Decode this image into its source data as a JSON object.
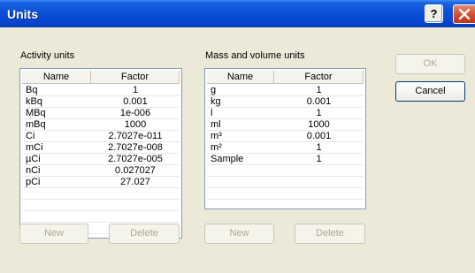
{
  "window": {
    "title": "Units",
    "help_glyph": "?"
  },
  "activity": {
    "label": "Activity units",
    "columns": {
      "name": "Name",
      "factor": "Factor"
    },
    "rows": [
      {
        "name": "Bq",
        "factor": "1"
      },
      {
        "name": "kBq",
        "factor": "0.001"
      },
      {
        "name": "MBq",
        "factor": "1e-006"
      },
      {
        "name": "mBq",
        "factor": "1000"
      },
      {
        "name": "Ci",
        "factor": "2.7027e-011"
      },
      {
        "name": "mCi",
        "factor": "2.7027e-008"
      },
      {
        "name": "µCi",
        "factor": "2.7027e-005"
      },
      {
        "name": "nCi",
        "factor": "0.027027"
      },
      {
        "name": "pCi",
        "factor": "27.027"
      }
    ],
    "new_label": "New",
    "delete_label": "Delete"
  },
  "mass": {
    "label": "Mass and volume units",
    "columns": {
      "name": "Name",
      "factor": "Factor"
    },
    "rows": [
      {
        "name": "g",
        "factor": "1"
      },
      {
        "name": "kg",
        "factor": "0.001"
      },
      {
        "name": "l",
        "factor": "1"
      },
      {
        "name": "ml",
        "factor": "1000"
      },
      {
        "name": "m³",
        "factor": "0.001"
      },
      {
        "name": "m²",
        "factor": "1"
      },
      {
        "name": "Sample",
        "factor": "1"
      }
    ],
    "new_label": "New",
    "delete_label": "Delete"
  },
  "buttons": {
    "ok": "OK",
    "cancel": "Cancel"
  }
}
